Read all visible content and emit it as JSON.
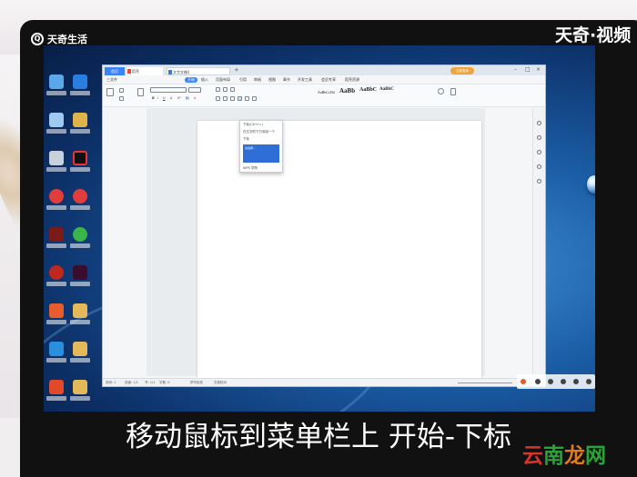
{
  "overlay": {
    "brand_left": "天奇生活",
    "brand_right": "天奇·视频",
    "subtitle": "移动鼠标到菜单栏上 开始-下标",
    "watermark": [
      "云",
      "南",
      "龙",
      "网"
    ]
  },
  "wps": {
    "tabs": {
      "home": "首页",
      "doc": "稻壳",
      "new_doc": "文字文稿1"
    },
    "login_label": "立即登录",
    "menus": [
      "三文件",
      "开始",
      "插入",
      "页面布局",
      "引用",
      "审阅",
      "视图",
      "章节",
      "开发工具",
      "会员专享",
      "稻壳资源"
    ],
    "styles": [
      "AaBbCcDd",
      "AaBb",
      "AaBbC",
      "AaBbC"
    ],
    "dropdown": {
      "item1": "下标(Ctrl+=)",
      "item2": "在文字的下方添加一个",
      "item3": "下标",
      "preview": "请选择...",
      "more": "WPS 学院"
    },
    "status": {
      "page": "页码: 1",
      "pages": "页面: 1/1",
      "section": "节: 1/1",
      "words": "字数: 0",
      "spell": "拼写检查",
      "doc_check": "文档校对",
      "zoom": "100%"
    }
  },
  "colors": {
    "accent": "#3b82f6",
    "login": "#f0a53b",
    "watermark_red": "#d9342b",
    "watermark_green": "#2aa338"
  }
}
